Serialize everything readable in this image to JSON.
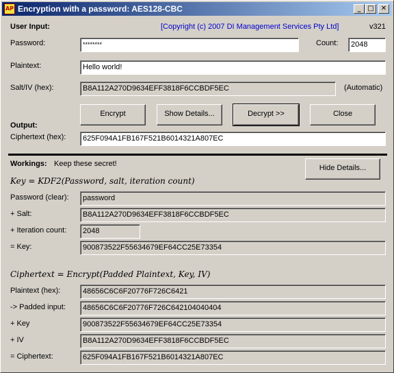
{
  "window": {
    "title": "Encryption with a password: AES128-CBC",
    "app_icon_text": "AP",
    "minimize_symbol": "_",
    "maximize_symbol": "□",
    "close_symbol": "✕"
  },
  "header": {
    "section_label": "User Input:",
    "copyright": "[Copyright (c) 2007 DI Management Services Pty Ltd]",
    "version": "v321"
  },
  "inputs": {
    "password_label": "Password:",
    "password_value": "********",
    "count_label": "Count:",
    "count_value": "2048",
    "plaintext_label": "Plaintext:",
    "plaintext_value": "Hello world!",
    "salt_label": "Salt/IV (hex):",
    "salt_value": "B8A112A270D9634EFF3818F6CCBDF5EC",
    "salt_mode": "(Automatic)"
  },
  "buttons": {
    "encrypt": "Encrypt",
    "show_details": "Show Details...",
    "decrypt": "Decrypt >>",
    "close": "Close",
    "hide_details": "Hide Details..."
  },
  "output": {
    "section_label": "Output:",
    "ciphertext_label": "Ciphertext (hex):",
    "ciphertext_value": "625F094A1FB167F521B6014321A807EC"
  },
  "workings": {
    "section_label": "Workings:",
    "note": "Keep these secret!",
    "kdf_formula": "Key = KDF2(Password, salt, iteration count)",
    "password_clear_label": "Password (clear):",
    "password_clear_value": "password",
    "salt_label": "+ Salt:",
    "salt_value": "B8A112A270D9634EFF3818F6CCBDF5EC",
    "iter_label": "+ Iteration count:",
    "iter_value": "2048",
    "key_label": "= Key:",
    "key_value": "900873522F55634679EF64CC25E73354",
    "enc_formula": "Ciphertext = Encrypt(Padded Plaintext, Key, IV)",
    "plain_hex_label": "Plaintext (hex):",
    "plain_hex_value": "48656C6C6F20776F726C6421",
    "padded_label": "-> Padded input:",
    "padded_value": "48656C6C6F20776F726C642104040404",
    "key2_label": "+ Key",
    "key2_value": "900873522F55634679EF64CC25E73354",
    "iv_label": "+ IV",
    "iv_value": "B8A112A270D9634EFF3818F6CCBDF5EC",
    "cipher_label": "= Ciphertext:",
    "cipher_value": "625F094A1FB167F521B6014321A807EC"
  }
}
